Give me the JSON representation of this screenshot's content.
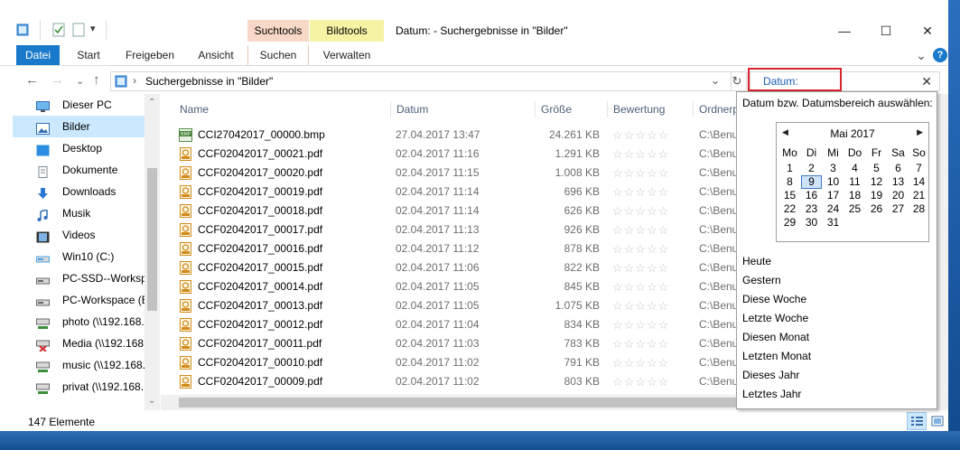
{
  "window": {
    "title": "Datum: - Suchergebnisse in \"Bilder\"",
    "context_tabs": {
      "search_tools": "Suchtools",
      "image_tools": "Bildtools"
    },
    "controls": {
      "minimize": "—",
      "maximize": "☐",
      "close": "✕"
    },
    "qat_dropdown": "▾"
  },
  "ribbon": {
    "tabs": [
      "Datei",
      "Start",
      "Freigeben",
      "Ansicht",
      "Suchen",
      "Verwalten"
    ],
    "expand_glyph": "⌄",
    "help_glyph": "?"
  },
  "address": {
    "back": "←",
    "forward": "→",
    "recent": "⌄",
    "up": "↑",
    "separator": "›",
    "path": "Suchergebnisse in \"Bilder\"",
    "dropdown": "⌄",
    "refresh": "↻"
  },
  "search": {
    "value": "Datum:",
    "clear": "✕"
  },
  "nav": {
    "items": [
      {
        "label": "Dieser PC",
        "icon": "computer-icon",
        "color": "#2f6fb7"
      },
      {
        "label": "Bilder",
        "icon": "pictures-folder-icon",
        "color": "#2f6fb7"
      },
      {
        "label": "Desktop",
        "icon": "desktop-icon",
        "color": "#2b8de0"
      },
      {
        "label": "Dokumente",
        "icon": "documents-icon",
        "color": "#7a8896"
      },
      {
        "label": "Downloads",
        "icon": "downloads-icon",
        "color": "#2b78d4"
      },
      {
        "label": "Musik",
        "icon": "music-icon",
        "color": "#2f6fb7"
      },
      {
        "label": "Videos",
        "icon": "videos-icon",
        "color": "#333333"
      },
      {
        "label": "Win10 (C:)",
        "icon": "drive-icon",
        "color": "#4aa3e8"
      },
      {
        "label": "PC-SSD--Workspace",
        "icon": "drive-icon",
        "color": "#666666"
      },
      {
        "label": "PC-Workspace (E:)",
        "icon": "drive-icon",
        "color": "#666666"
      },
      {
        "label": "photo (\\\\192.168.",
        "icon": "network-drive-icon",
        "color": "#3a8f3a"
      },
      {
        "label": "Media (\\\\192.168.",
        "icon": "network-drive-disconnected-icon",
        "color": "#d12a2a"
      },
      {
        "label": "music (\\\\192.168.",
        "icon": "network-drive-icon",
        "color": "#3a8f3a"
      },
      {
        "label": "privat (\\\\192.168.",
        "icon": "network-drive-icon",
        "color": "#3a8f3a"
      }
    ],
    "selected_index": 1,
    "scroll_up": "⌃",
    "scroll_down": "⌄"
  },
  "columns": [
    "Name",
    "Datum",
    "Größe",
    "Bewertung",
    "Ordnerp"
  ],
  "files": [
    {
      "name": "CCI27042017_00000.bmp",
      "date": "27.04.2017 13:47",
      "size": "24.261 KB",
      "rating": "☆☆☆☆☆",
      "path": "C:\\Benu",
      "type": "bmp"
    },
    {
      "name": "CCF02042017_00021.pdf",
      "date": "02.04.2017 11:16",
      "size": "1.291 KB",
      "rating": "☆☆☆☆☆",
      "path": "C:\\Benu",
      "type": "pdf"
    },
    {
      "name": "CCF02042017_00020.pdf",
      "date": "02.04.2017 11:15",
      "size": "1.008 KB",
      "rating": "☆☆☆☆☆",
      "path": "C:\\Benu",
      "type": "pdf"
    },
    {
      "name": "CCF02042017_00019.pdf",
      "date": "02.04.2017 11:14",
      "size": "696 KB",
      "rating": "☆☆☆☆☆",
      "path": "C:\\Benu",
      "type": "pdf"
    },
    {
      "name": "CCF02042017_00018.pdf",
      "date": "02.04.2017 11:14",
      "size": "626 KB",
      "rating": "☆☆☆☆☆",
      "path": "C:\\Benu",
      "type": "pdf"
    },
    {
      "name": "CCF02042017_00017.pdf",
      "date": "02.04.2017 11:13",
      "size": "926 KB",
      "rating": "☆☆☆☆☆",
      "path": "C:\\Benu",
      "type": "pdf"
    },
    {
      "name": "CCF02042017_00016.pdf",
      "date": "02.04.2017 11:12",
      "size": "878 KB",
      "rating": "☆☆☆☆☆",
      "path": "C:\\Benu",
      "type": "pdf"
    },
    {
      "name": "CCF02042017_00015.pdf",
      "date": "02.04.2017 11:06",
      "size": "822 KB",
      "rating": "☆☆☆☆☆",
      "path": "C:\\Benu",
      "type": "pdf"
    },
    {
      "name": "CCF02042017_00014.pdf",
      "date": "02.04.2017 11:05",
      "size": "845 KB",
      "rating": "☆☆☆☆☆",
      "path": "C:\\Benu",
      "type": "pdf"
    },
    {
      "name": "CCF02042017_00013.pdf",
      "date": "02.04.2017 11:05",
      "size": "1.075 KB",
      "rating": "☆☆☆☆☆",
      "path": "C:\\Benu",
      "type": "pdf"
    },
    {
      "name": "CCF02042017_00012.pdf",
      "date": "02.04.2017 11:04",
      "size": "834 KB",
      "rating": "☆☆☆☆☆",
      "path": "C:\\Benu",
      "type": "pdf"
    },
    {
      "name": "CCF02042017_00011.pdf",
      "date": "02.04.2017 11:03",
      "size": "783 KB",
      "rating": "☆☆☆☆☆",
      "path": "C:\\Benu",
      "type": "pdf"
    },
    {
      "name": "CCF02042017_00010.pdf",
      "date": "02.04.2017 11:02",
      "size": "791 KB",
      "rating": "☆☆☆☆☆",
      "path": "C:\\Benu",
      "type": "pdf"
    },
    {
      "name": "CCF02042017_00009.pdf",
      "date": "02.04.2017 11:02",
      "size": "803 KB",
      "rating": "☆☆☆☆☆",
      "path": "C:\\Benu",
      "type": "pdf"
    }
  ],
  "date_picker": {
    "prompt": "Datum bzw. Datumsbereich auswählen:",
    "month": "Mai 2017",
    "prev": "◀",
    "next": "▶",
    "weekdays": [
      "Mo",
      "Di",
      "Mi",
      "Do",
      "Fr",
      "Sa",
      "So"
    ],
    "first_weekday_offset": 0,
    "days_in_month": 31,
    "selected_day": 9,
    "presets": [
      "Heute",
      "Gestern",
      "Diese Woche",
      "Letzte Woche",
      "Diesen Monat",
      "Letzten Monat",
      "Dieses Jahr",
      "Letztes Jahr"
    ]
  },
  "status": {
    "count": "147 Elemente"
  },
  "colors": {
    "accent": "#1979ca",
    "search_tools_tab": "#f8d9c8",
    "image_tools_tab": "#f6f4a4",
    "highlight": "#d9242c",
    "selection": "#cce8ff"
  }
}
